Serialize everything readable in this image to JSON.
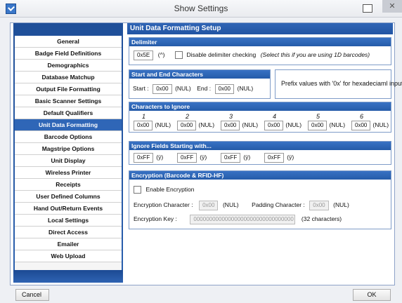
{
  "window": {
    "title": "Show Settings"
  },
  "sidebar": {
    "items": [
      {
        "label": "General"
      },
      {
        "label": "Badge Field Definitions"
      },
      {
        "label": "Demographics"
      },
      {
        "label": "Database Matchup"
      },
      {
        "label": "Output File Formatting"
      },
      {
        "label": "Basic Scanner Settings"
      },
      {
        "label": "Default Qualifiers"
      },
      {
        "label": "Unit Data Formatting"
      },
      {
        "label": "Barcode Options"
      },
      {
        "label": "Magstripe Options"
      },
      {
        "label": "Unit Display"
      },
      {
        "label": "Wireless Printer"
      },
      {
        "label": "Receipts"
      },
      {
        "label": "User Defined Columns"
      },
      {
        "label": "Hand Out/Return Events"
      },
      {
        "label": "Local Settings"
      },
      {
        "label": "Direct Access"
      },
      {
        "label": "Emailer"
      },
      {
        "label": "Web Upload"
      }
    ],
    "selected": "Unit Data Formatting"
  },
  "content": {
    "title": "Unit Data Formatting Setup",
    "delimiter": {
      "header": "Delimiter",
      "value": "0x5E",
      "char": "(^)",
      "disable_label": "Disable delimiter checking",
      "hint": "(Select this if you are using 1D barcodes)"
    },
    "start_end": {
      "header": "Start and End Characters",
      "start_label": "Start :",
      "start_value": "0x00",
      "start_char": "(NUL)",
      "end_label": "End :",
      "end_value": "0x00",
      "end_char": "(NUL)"
    },
    "prefix_note": "Prefix values with '0x' for hexadeciaml input",
    "ignore_chars": {
      "header": "Characters to Ignore",
      "items": [
        {
          "num": "1",
          "value": "0x00",
          "char": "(NUL)"
        },
        {
          "num": "2",
          "value": "0x00",
          "char": "(NUL)"
        },
        {
          "num": "3",
          "value": "0x00",
          "char": "(NUL)"
        },
        {
          "num": "4",
          "value": "0x00",
          "char": "(NUL)"
        },
        {
          "num": "5",
          "value": "0x00",
          "char": "(NUL)"
        },
        {
          "num": "6",
          "value": "0x00",
          "char": "(NUL)"
        }
      ]
    },
    "ignore_fields": {
      "header": "Ignore Fields Starting with...",
      "items": [
        {
          "value": "0xFF",
          "char": "(ÿ)"
        },
        {
          "value": "0xFF",
          "char": "(ÿ)"
        },
        {
          "value": "0xFF",
          "char": "(ÿ)"
        },
        {
          "value": "0xFF",
          "char": "(ÿ)"
        }
      ]
    },
    "encryption": {
      "header": "Encryption (Barcode & RFID-HF)",
      "enable_label": "Enable Encryption",
      "char_label": "Encryption Character :",
      "char_value": "0x00",
      "char_char": "(NUL)",
      "pad_label": "Padding Character :",
      "pad_value": "0x00",
      "pad_char": "(NUL)",
      "key_label": "Encryption Key :",
      "key_value": "00000000000000000000000000000000",
      "key_note": "(32 characters)"
    }
  },
  "footer": {
    "cancel": "Cancel",
    "ok": "OK"
  }
}
